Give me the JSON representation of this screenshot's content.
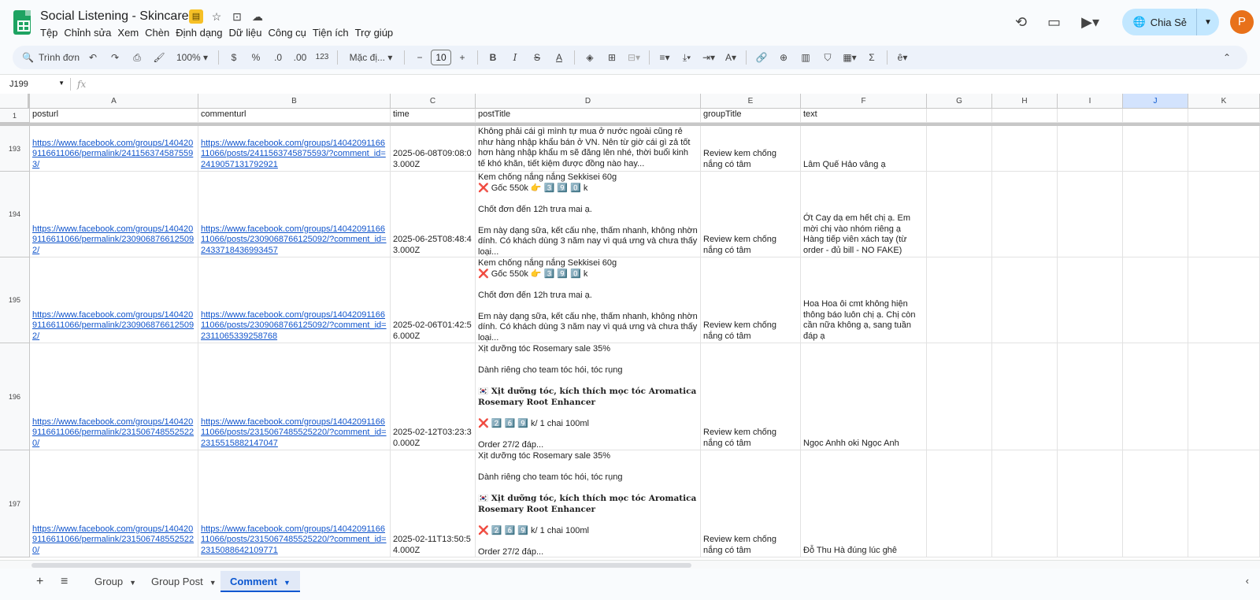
{
  "app": {
    "doc_title": "Social Listening - Skincare",
    "menu": [
      "Tệp",
      "Chỉnh sửa",
      "Xem",
      "Chèn",
      "Định dạng",
      "Dữ liệu",
      "Công cụ",
      "Tiện ích",
      "Trợ giúp"
    ],
    "share_label": "Chia Sẻ",
    "avatar_letter": "P"
  },
  "toolbar": {
    "search_label": "Trình đơn",
    "zoom": "100%",
    "currency": "$",
    "percent": "%",
    "dec_decrease": ".0",
    "dec_increase": ".00",
    "number_format": "123",
    "font": "Mặc đị...",
    "font_size": "10"
  },
  "formula_bar": {
    "cell_ref": "J199",
    "fx": "fx"
  },
  "columns": [
    {
      "letter": "A"
    },
    {
      "letter": "B"
    },
    {
      "letter": "C"
    },
    {
      "letter": "D"
    },
    {
      "letter": "E"
    },
    {
      "letter": "F"
    },
    {
      "letter": "G"
    },
    {
      "letter": "H"
    },
    {
      "letter": "I"
    },
    {
      "letter": "J",
      "selected": true
    },
    {
      "letter": "K"
    }
  ],
  "header_row": {
    "num": "1",
    "cells": [
      "posturl",
      "commenturl",
      "time",
      "postTitle",
      "groupTitle",
      "text"
    ]
  },
  "rows": [
    {
      "num": "193",
      "posturl": "https://www.facebook.com/groups/1404209116611066/permalink/2411563745875593/",
      "commenturl": "https://www.facebook.com/groups/1404209116611066/posts/2411563745875593/?comment_id=2419057131792921",
      "time": "2025-06-08T09:08:03.000Z",
      "postTitle": "Không phải cái gì mình tự mua ở nước ngoài cũng rẻ như hàng nhập khẩu bán ở VN. Nên từ giờ cái gì zả tốt hơn hàng nhập khẩu m sẽ đăng lên nhé, thời buổi kinh tế khó khăn, tiết kiệm được đồng nào hay...",
      "groupTitle": "Review kem chống nắng có tâm",
      "text": "Lâm Quế Hảo vâng ạ"
    },
    {
      "num": "194",
      "posturl": "https://www.facebook.com/groups/1404209116611066/permalink/2309068766125092/",
      "commenturl": "https://www.facebook.com/groups/1404209116611066/posts/2309068766125092/?comment_id=2433718436993457",
      "time": "2025-06-25T08:48:43.000Z",
      "postTitle": "Kem chống nắng nắng Sekkisei 60g\n❌ Gốc 550k 👉 3️⃣ 9️⃣ 0️⃣ k\n\nChốt đơn đến 12h trưa mai ạ.\n\nEm này dạng sữa, kết cấu nhẹ, thấm nhanh, không nhờn dính. Có khách dùng 3 năm nay vì quá ưng và chưa thấy loại...",
      "groupTitle": "Review kem chống nắng có tâm",
      "text": "Ớt Cay dạ em hết chị ạ. Em mời chị vào nhóm riêng ạ Hàng tiếp viên xách tay (từ order - đủ bill - NO FAKE)"
    },
    {
      "num": "195",
      "posturl": "https://www.facebook.com/groups/1404209116611066/permalink/2309068766125092/",
      "commenturl": "https://www.facebook.com/groups/1404209116611066/posts/2309068766125092/?comment_id=2311065339258768",
      "time": "2025-02-06T01:42:56.000Z",
      "postTitle": "Kem chống nắng nắng Sekkisei 60g\n❌ Gốc 550k 👉 3️⃣ 9️⃣ 0️⃣ k\n\nChốt đơn đến 12h trưa mai ạ.\n\nEm này dạng sữa, kết cấu nhẹ, thấm nhanh, không nhờn dính. Có khách dùng 3 năm nay vì quá ưng và chưa thấy loại...",
      "groupTitle": "Review kem chống nắng có tâm",
      "text": "Hoa Hoa ôi cmt không hiện thông báo luôn chị ạ. Chị còn cần nữa không ạ, sang tuần đáp ạ"
    },
    {
      "num": "196",
      "posturl": "https://www.facebook.com/groups/1404209116611066/permalink/2315067485525220/",
      "commenturl": "https://www.facebook.com/groups/1404209116611066/posts/2315067485525220/?comment_id=2315515882147047",
      "time": "2025-02-12T03:23:30.000Z",
      "postTitle_lines": [
        "Xịt dưỡng tóc Rosemary sale 35%",
        "",
        "Dành riêng cho team tóc hói, tóc rụng",
        ""
      ],
      "postTitle_bold": "🇰🇷 Xịt dưỡng tóc, kích thích mọc tóc Aromatica Rosemary Root Enhancer",
      "postTitle_tail": [
        "",
        "❌ 2️⃣ 6️⃣ 9️⃣ k/ 1 chai 100ml",
        "",
        "Order 27/2 đáp..."
      ],
      "groupTitle": "Review kem chống nắng có tâm",
      "text": "Ngọc Anhh oki Ngọc Anh"
    },
    {
      "num": "197",
      "posturl": "https://www.facebook.com/groups/1404209116611066/permalink/2315067485525220/",
      "commenturl": "https://www.facebook.com/groups/1404209116611066/posts/2315067485525220/?comment_id=2315088642109771",
      "time": "2025-02-11T13:50:54.000Z",
      "postTitle_lines": [
        "Xịt dưỡng tóc Rosemary sale 35%",
        "",
        "Dành riêng cho team tóc hói, tóc rụng",
        ""
      ],
      "postTitle_bold": "🇰🇷 Xịt dưỡng tóc, kích thích mọc tóc Aromatica Rosemary Root Enhancer",
      "postTitle_tail": [
        "",
        "❌ 2️⃣ 6️⃣ 9️⃣ k/ 1 chai 100ml",
        "",
        "Order 27/2 đáp..."
      ],
      "groupTitle": "Review kem chống nắng có tâm",
      "text": "Đỗ Thu Hà đúng lúc ghê"
    }
  ],
  "sheets": [
    {
      "name": "Group",
      "active": false
    },
    {
      "name": "Group Post",
      "active": false
    },
    {
      "name": "Comment",
      "active": true
    }
  ]
}
